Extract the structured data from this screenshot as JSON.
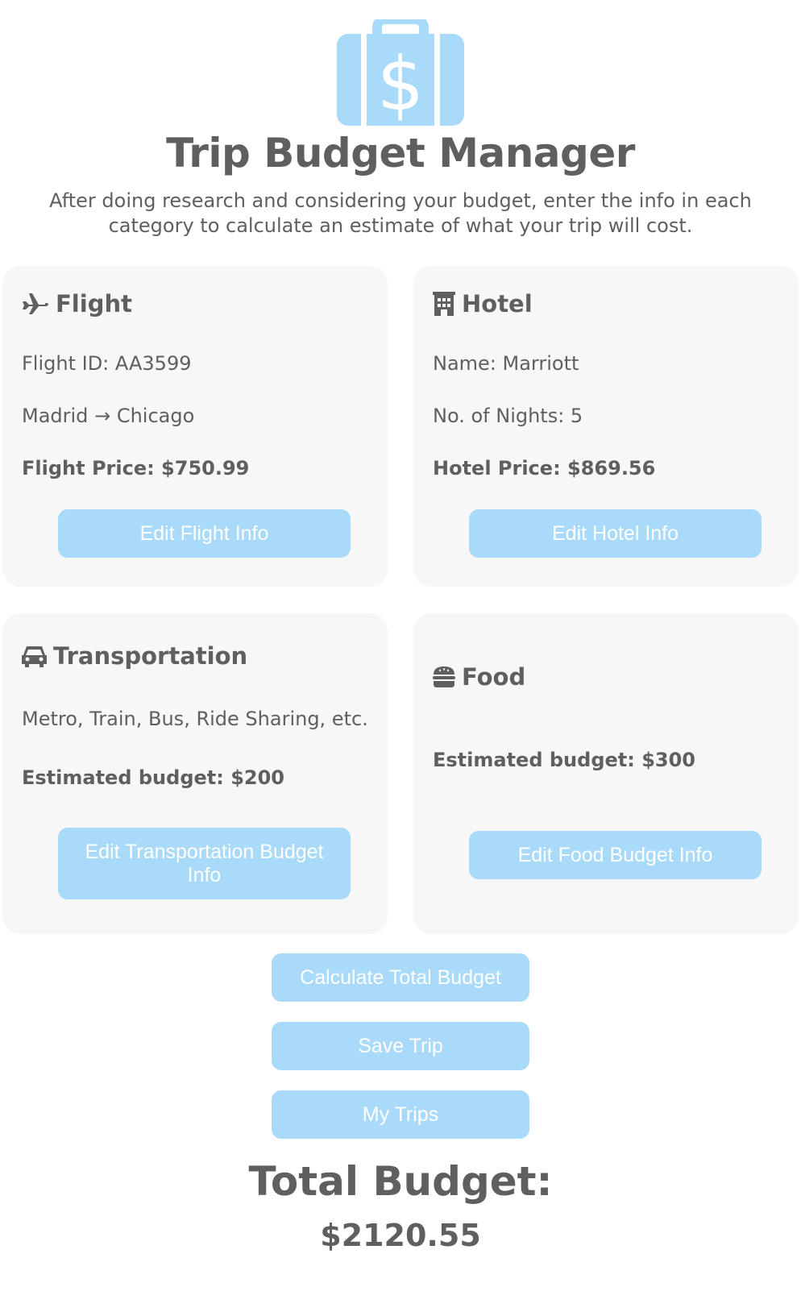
{
  "header": {
    "logo_icon": "suitcase-dollar-icon",
    "title": "Trip Budget Manager",
    "subtitle": "After doing research and considering your budget, enter the info in each category to calculate an estimate of what your trip will cost."
  },
  "flight": {
    "icon": "plane-icon",
    "heading": "Flight",
    "id_text": "Flight ID: AA3599",
    "origin": "Madrid",
    "arrow": "→",
    "destination": "Chicago",
    "price_text": "Flight Price: $750.99",
    "button": "Edit Flight Info"
  },
  "hotel": {
    "icon": "building-icon",
    "heading": "Hotel",
    "name_text": "Name: Marriott",
    "nights_text": "No. of Nights: 5",
    "price_text": "Hotel Price: $869.56",
    "button": "Edit Hotel Info"
  },
  "transportation": {
    "icon": "car-icon",
    "heading": "Transportation",
    "description": "Metro, Train, Bus, Ride Sharing, etc.",
    "budget_text": "Estimated budget: $200",
    "button": "Edit Transportation Budget Info"
  },
  "food": {
    "icon": "burger-icon",
    "heading": "Food",
    "budget_text": "Estimated budget: $300",
    "button": "Edit Food Budget Info"
  },
  "actions": {
    "calculate": "Calculate Total Budget",
    "save": "Save Trip",
    "my_trips": "My Trips"
  },
  "total": {
    "label": "Total Budget:",
    "value": "$2120.55"
  },
  "colors": {
    "accent": "#a9dafa",
    "text": "#5f5f5f",
    "card_bg": "#f7f7f7"
  }
}
